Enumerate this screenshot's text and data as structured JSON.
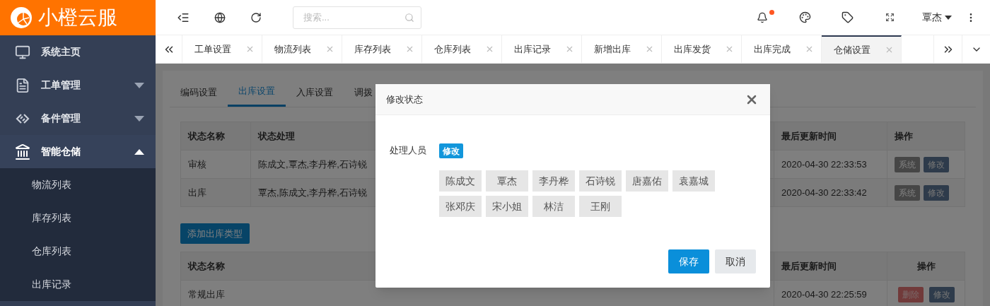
{
  "header": {
    "logo": "小橙云服",
    "search": {
      "placeholder": "搜索..."
    },
    "notification_dot": true,
    "user": "覃杰"
  },
  "sidebar": {
    "items": [
      {
        "label": "系统主页",
        "kind": "monitor"
      },
      {
        "label": "工单管理",
        "kind": "document",
        "expanded": false
      },
      {
        "label": "备件管理",
        "kind": "parts",
        "expanded": false
      },
      {
        "label": "智能仓储",
        "kind": "warehouse",
        "expanded": true,
        "children": [
          {
            "label": "物流列表"
          },
          {
            "label": "库存列表"
          },
          {
            "label": "仓库列表"
          },
          {
            "label": "出库记录"
          }
        ]
      }
    ]
  },
  "page_tabs": [
    {
      "label": "工单设置",
      "selected": false
    },
    {
      "label": "物流列表",
      "selected": false
    },
    {
      "label": "库存列表",
      "selected": false
    },
    {
      "label": "仓库列表",
      "selected": false
    },
    {
      "label": "出库记录",
      "selected": false
    },
    {
      "label": "新增出库",
      "selected": false
    },
    {
      "label": "出库发货",
      "selected": false
    },
    {
      "label": "出库完成",
      "selected": false
    },
    {
      "label": "仓储设置",
      "selected": true
    }
  ],
  "settings_tabs": [
    {
      "label": "编码设置",
      "selected": false
    },
    {
      "label": "出库设置",
      "selected": true
    },
    {
      "label": "入库设置",
      "selected": false
    },
    {
      "label": "调拨",
      "selected": false
    }
  ],
  "status_table": {
    "columns": [
      "状态名称",
      "状态处理",
      "最后更新时间",
      "操作"
    ],
    "rows": [
      {
        "name": "审核",
        "handlers": "陈成文,覃杰,李丹桦,石诗锐",
        "updated": "2020-04-30 22:33:53",
        "actions": [
          {
            "label": "系统",
            "kind": "system"
          },
          {
            "label": "修改",
            "kind": "edit"
          }
        ]
      },
      {
        "name": "出库",
        "handlers": "覃杰,陈成文,李丹桦,石诗锐",
        "updated": "2020-04-30 22:33:42",
        "actions": [
          {
            "label": "系统",
            "kind": "system"
          },
          {
            "label": "修改",
            "kind": "edit"
          }
        ]
      }
    ]
  },
  "add_button": "添加出库类型",
  "type_table": {
    "columns": [
      "状态名称",
      "最后更新时间",
      "操作"
    ],
    "rows": [
      {
        "name": "常规出库",
        "updated": "2020-04-30 22:25:59",
        "actions": [
          {
            "label": "删除",
            "kind": "delete"
          },
          {
            "label": "修改",
            "kind": "edit"
          }
        ]
      }
    ]
  },
  "modal": {
    "title": "修改状态",
    "field_label": "处理人员",
    "edit_button": "修改",
    "people": [
      "陈成文",
      "覃杰",
      "李丹桦",
      "石诗锐",
      "唐嘉佑",
      "袁嘉城",
      "张邓庆",
      "宋小姐",
      "林洁",
      "王刚"
    ],
    "buttons": [
      {
        "label": "保存",
        "kind": "primary"
      },
      {
        "label": "取消",
        "kind": "secondary"
      }
    ]
  }
}
